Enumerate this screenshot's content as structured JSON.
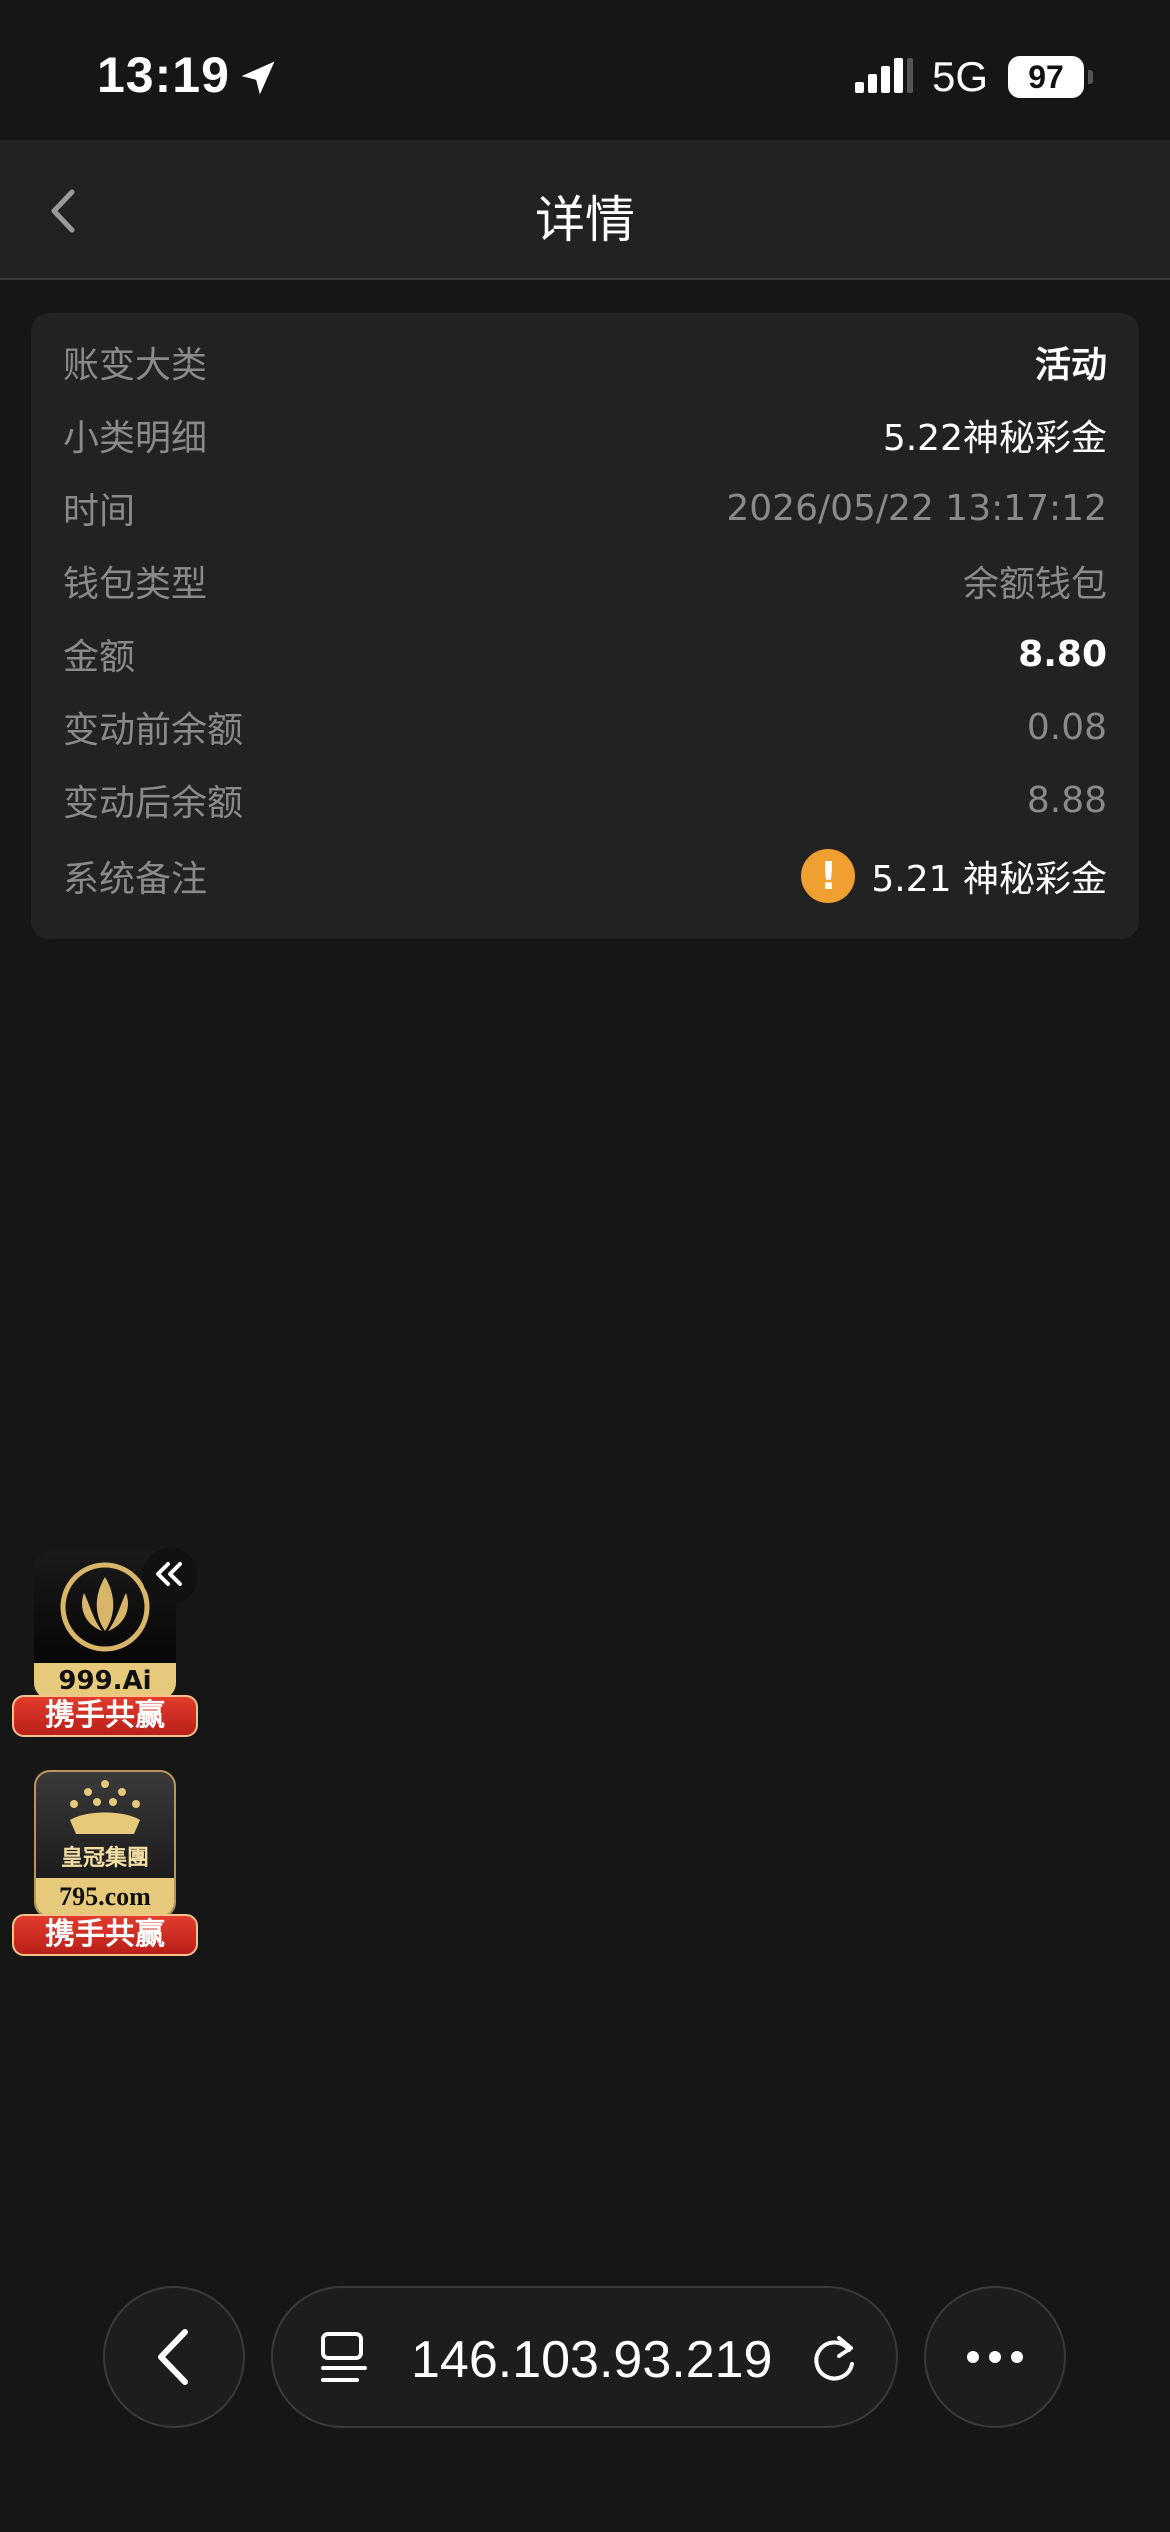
{
  "status_bar": {
    "time": "13:19",
    "network": "5G",
    "battery": "97"
  },
  "header": {
    "title": "详情"
  },
  "details": [
    {
      "label": "账变大类",
      "value": "活动",
      "style": "bold"
    },
    {
      "label": "小类明细",
      "value": "5.22神秘彩金",
      "style": "white"
    },
    {
      "label": "时间",
      "value": "2026/05/22 13:17:12",
      "style": "muted"
    },
    {
      "label": "钱包类型",
      "value": "余额钱包",
      "style": "muted"
    },
    {
      "label": "金额",
      "value": "8.80",
      "style": "bold"
    },
    {
      "label": "变动前余额",
      "value": "0.08",
      "style": "muted"
    },
    {
      "label": "变动后余额",
      "value": "8.88",
      "style": "muted"
    },
    {
      "label": "系统备注",
      "value": "5.21 神秘彩金",
      "style": "white",
      "icon": "warning-icon"
    }
  ],
  "promos": [
    {
      "brand": "999.Ai",
      "ribbon": "携手共赢"
    },
    {
      "brand_top": "皇冠集團",
      "brand": "795.com",
      "ribbon": "携手共赢"
    }
  ],
  "browser": {
    "url": "146.103.93.219"
  },
  "colors": {
    "background": "#161616",
    "card": "#222222",
    "warning": "#f0a030",
    "ribbon": "#c8281e",
    "gold": "#d9b56a"
  }
}
